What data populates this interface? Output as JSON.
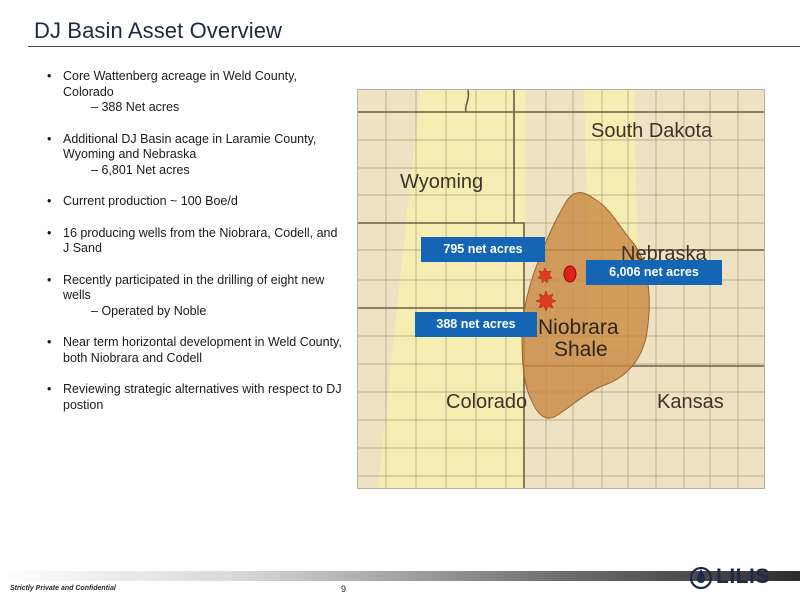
{
  "slide": {
    "title": "DJ Basin Asset Overview",
    "page_number": "9",
    "footer": "Strictly Private and Confidential",
    "logo_text": "LILIS"
  },
  "bullets": [
    {
      "text": "Core Wattenberg acreage in Weld County, Colorado",
      "sub": "388 Net acres"
    },
    {
      "text": "Additional DJ Basin acage in Laramie County, Wyoming and Nebraska",
      "sub": "6,801 Net acres"
    },
    {
      "text": "Current production ~ 100 Boe/d"
    },
    {
      "text": "16 producing wells from the Niobrara, Codell, and J Sand"
    },
    {
      "text": "Recently participated in the drilling of eight new wells",
      "sub": "Operated by Noble"
    },
    {
      "text": "Near term horizontal development in Weld County, both Niobrara and Codell"
    },
    {
      "text": "Reviewing strategic alternatives with respect to DJ postion"
    }
  ],
  "map": {
    "state_labels": {
      "south_dakota": "South Dakota",
      "wyoming": "Wyoming",
      "nebraska": "Nebraska",
      "colorado": "Colorado",
      "kansas": "Kansas"
    },
    "shale_label_line1": "Niobrara",
    "shale_label_line2": "Shale",
    "callouts": {
      "c795": "795 net acres",
      "c6006": "6,006 net acres",
      "c388": "388 net acres"
    }
  },
  "colors": {
    "title": "#1b2a44",
    "callout_bg": "#1466b4",
    "shale": "#c98a45",
    "map_bg": "#efe2c2",
    "yellow_band": "#f6eeb0"
  }
}
